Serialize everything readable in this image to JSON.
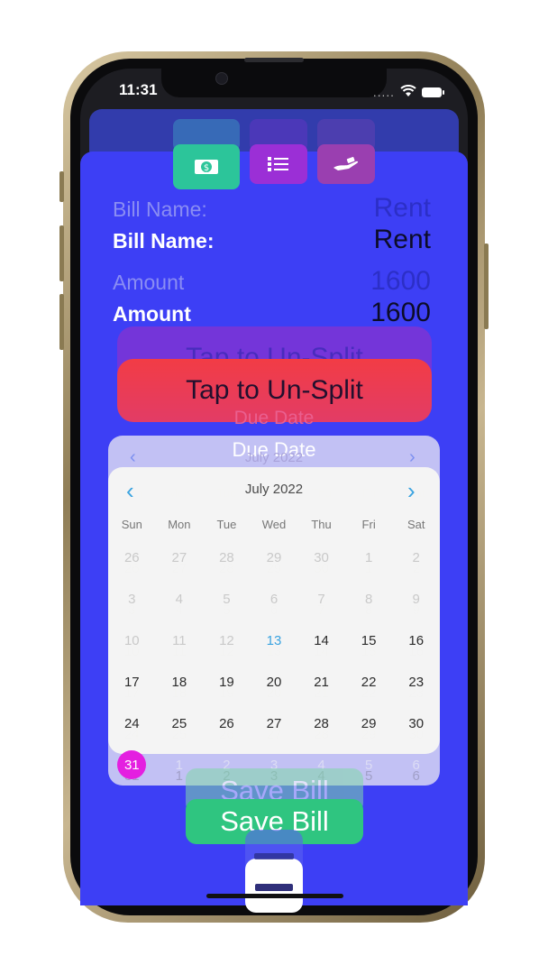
{
  "status_bar": {
    "time": "11:31",
    "signal": "....."
  },
  "tab_icons": [
    {
      "name": "money-icon",
      "color": "#2cc59a",
      "glyph": "$"
    },
    {
      "name": "list-icon",
      "color": "#9b2fd6"
    },
    {
      "name": "hand-icon",
      "color": "#9a3fb0"
    }
  ],
  "form": {
    "bill_name_label": "Bill Name:",
    "bill_name_value": "Rent",
    "amount_label": "Amount",
    "amount_value": "1600",
    "split_button": "Tap to Un-Split",
    "due_date_label": "Due Date"
  },
  "calendar": {
    "month_label": "July 2022",
    "weekdays": [
      "Sun",
      "Mon",
      "Tue",
      "Wed",
      "Thu",
      "Fri",
      "Sat"
    ],
    "weeks": [
      [
        "26",
        "27",
        "28",
        "29",
        "30",
        "1",
        "2"
      ],
      [
        "3",
        "4",
        "5",
        "6",
        "7",
        "8",
        "9"
      ],
      [
        "10",
        "11",
        "12",
        "13",
        "14",
        "15",
        "16"
      ],
      [
        "17",
        "18",
        "19",
        "20",
        "21",
        "22",
        "23"
      ],
      [
        "24",
        "25",
        "26",
        "27",
        "28",
        "29",
        "30"
      ],
      [
        "31",
        "1",
        "2",
        "3",
        "4",
        "5",
        "6"
      ]
    ],
    "today": "13",
    "selected": "31",
    "colors": {
      "accent": "#3aa3e0",
      "selected": "#e41fe0"
    }
  },
  "save_button": "Save Bill",
  "colors": {
    "sheet": "#3d3ff5",
    "split": "#f3394f",
    "save": "#2fc580"
  }
}
